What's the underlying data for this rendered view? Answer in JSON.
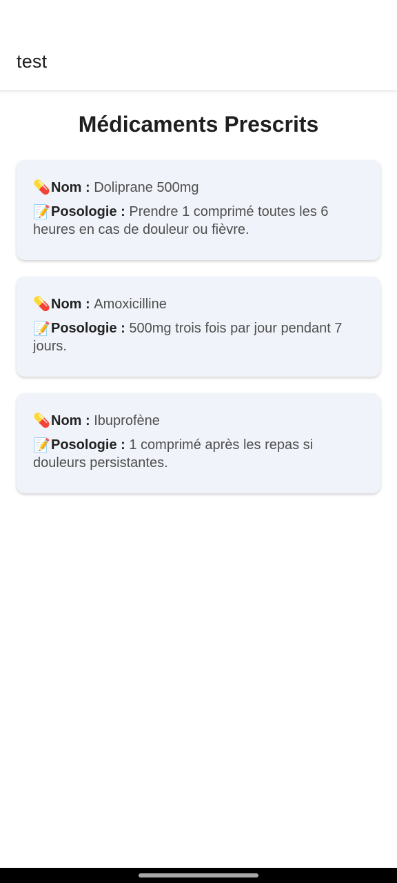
{
  "app_bar": {
    "title": "test"
  },
  "page": {
    "title": "Médicaments Prescrits"
  },
  "labels": {
    "name": "Nom :",
    "dosage": "Posologie :"
  },
  "icons": {
    "pill": "pill-icon",
    "memo": "memo-icon"
  },
  "medications": [
    {
      "name": "Doliprane 500mg",
      "dosage": "Prendre 1 comprimé toutes les 6 heures en cas de douleur ou fièvre."
    },
    {
      "name": "Amoxicilline",
      "dosage": "500mg trois fois par jour pendant 7 jours."
    },
    {
      "name": "Ibuprofène",
      "dosage": "1 comprimé après les repas si douleurs persistantes."
    }
  ],
  "colors": {
    "card_bg": "#f0f3f9",
    "label": "#222222",
    "value": "#4f4f4f"
  }
}
